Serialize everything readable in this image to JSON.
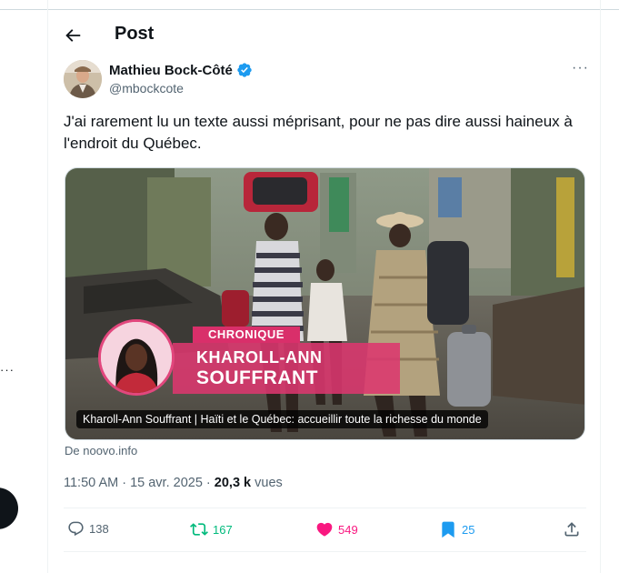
{
  "header": {
    "title": "Post"
  },
  "author": {
    "name": "Mathieu Bock-Côté",
    "handle": "@mbockcote"
  },
  "tweet": {
    "text": "J'ai rarement lu un texte aussi méprisant, pour ne pas dire aussi haineux à l'endroit du Québec."
  },
  "card": {
    "badge": "CHRONIQUE",
    "name_first": "KHAROLL-ANN",
    "name_last": "SOUFFRANT",
    "caption": "Kharoll-Ann Souffrant | Haïti et le Québec: accueillir toute la richesse du monde",
    "source": "De noovo.info"
  },
  "meta": {
    "time_date": "11:50 AM · 15 avr. 2025 · ",
    "views_count": "20,3 k",
    "views_label": " vues"
  },
  "actions": {
    "replies": "138",
    "reposts": "167",
    "likes": "549",
    "bookmarks": "25"
  },
  "colors": {
    "verified": "#1d9bf0",
    "repost": "#00ba7c",
    "like": "#f91880",
    "bookmark": "#1d9bf0",
    "chronique": "#d92f6a"
  },
  "icons": [
    "back-arrow-icon",
    "verified-badge-icon",
    "more-icon",
    "reply-icon",
    "repost-icon",
    "heart-icon",
    "bookmark-icon",
    "share-icon"
  ]
}
